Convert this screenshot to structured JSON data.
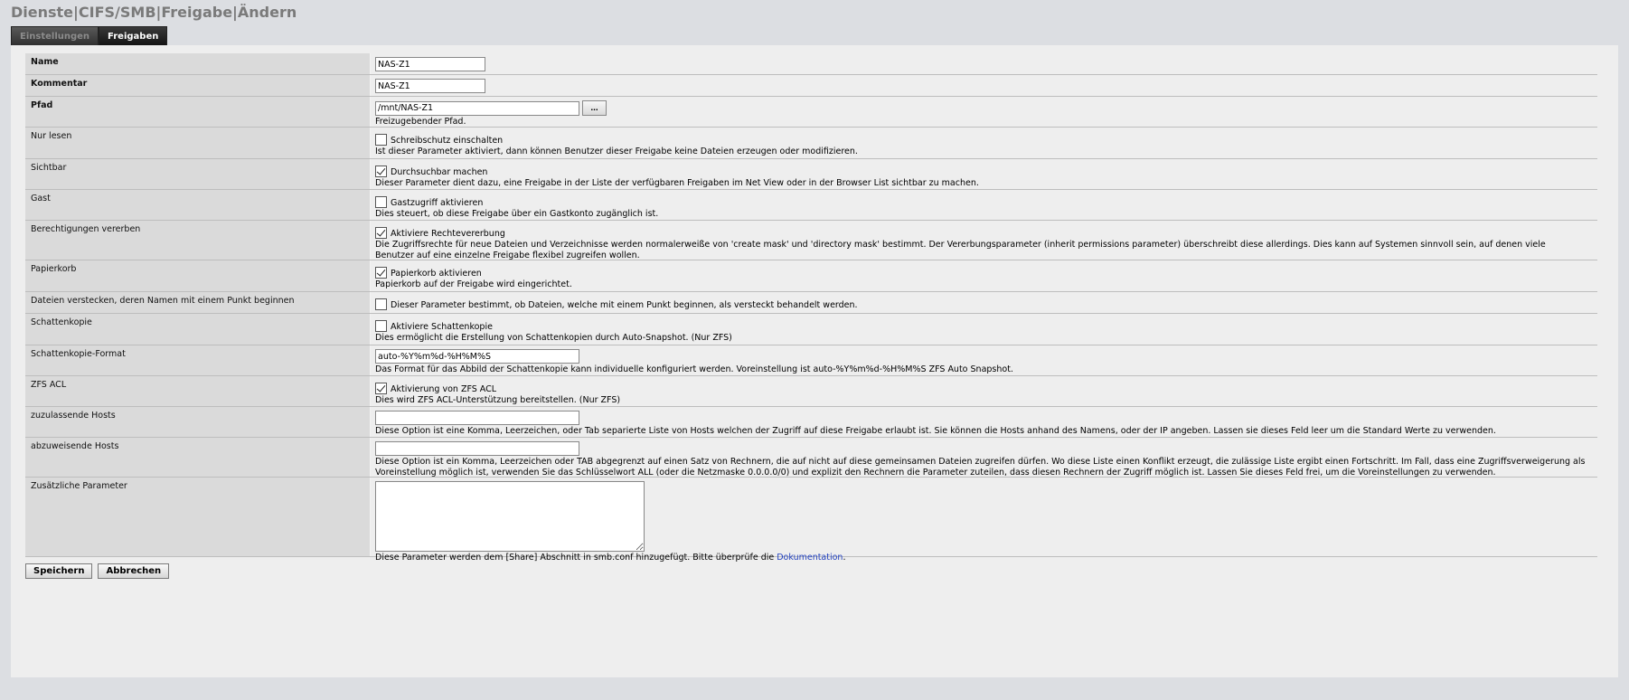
{
  "breadcrumb": "Dienste|CIFS/SMB|Freigabe|Ändern",
  "tabs": [
    {
      "label": "Einstellungen",
      "active": false
    },
    {
      "label": "Freigaben",
      "active": true
    }
  ],
  "fields": {
    "name": {
      "label": "Name",
      "value": "NAS-Z1"
    },
    "comment": {
      "label": "Kommentar",
      "value": "NAS-Z1"
    },
    "path": {
      "label": "Pfad",
      "value": "/mnt/NAS-Z1",
      "browse": "...",
      "desc": "Freizugebender Pfad."
    },
    "readonly": {
      "label": "Nur lesen",
      "checkbox": "Schreibschutz einschalten",
      "checked": false,
      "desc": "Ist dieser Parameter aktiviert, dann können Benutzer dieser Freigabe keine Dateien erzeugen oder modifizieren."
    },
    "browseable": {
      "label": "Sichtbar",
      "checkbox": "Durchsuchbar machen",
      "checked": true,
      "desc": "Dieser Parameter dient dazu, eine Freigabe in der Liste der verfügbaren Freigaben im Net View oder in der Browser List sichtbar zu machen."
    },
    "guest": {
      "label": "Gast",
      "checkbox": "Gastzugriff aktivieren",
      "checked": false,
      "desc": "Dies steuert, ob diese Freigabe über ein Gastkonto zugänglich ist."
    },
    "inherit": {
      "label": "Berechtigungen vererben",
      "checkbox": "Aktiviere Rechtevererbung",
      "checked": true,
      "desc": "Die Zugriffsrechte für neue Dateien und Verzeichnisse werden normalerweiße von 'create mask' und 'directory mask' bestimmt. Der Vererbungsparameter (inherit permissions parameter) überschreibt diese allerdings. Dies kann auf Systemen sinnvoll sein, auf denen viele Benutzer auf eine einzelne Freigabe flexibel zugreifen wollen."
    },
    "recycle": {
      "label": "Papierkorb",
      "checkbox": "Papierkorb aktivieren",
      "checked": true,
      "desc": "Papierkorb auf der Freigabe wird eingerichtet."
    },
    "hidedot": {
      "label": "Dateien verstecken, deren Namen mit einem Punkt beginnen",
      "checkbox": "Dieser Parameter bestimmt, ob Dateien, welche mit einem Punkt beginnen, als versteckt behandelt werden.",
      "checked": false
    },
    "shadowcopy": {
      "label": "Schattenkopie",
      "checkbox": "Aktiviere Schattenkopie",
      "checked": false,
      "desc": "Dies ermöglicht die Erstellung von Schattenkopien durch Auto-Snapshot. (Nur ZFS)"
    },
    "shadowformat": {
      "label": "Schattenkopie-Format",
      "value": "auto-%Y%m%d-%H%M%S",
      "desc": "Das Format für das Abbild der Schattenkopie kann individuelle konfiguriert werden. Voreinstellung ist auto-%Y%m%d-%H%M%S ZFS Auto Snapshot."
    },
    "zfsacl": {
      "label": "ZFS ACL",
      "checkbox": "Aktivierung von ZFS ACL",
      "checked": true,
      "desc": "Dies wird ZFS ACL-Unterstützung bereitstellen. (Nur ZFS)"
    },
    "hostsallow": {
      "label": "zuzulassende Hosts",
      "value": "",
      "desc": "Diese Option ist eine Komma, Leerzeichen, oder Tab separierte Liste von Hosts welchen der Zugriff auf diese Freigabe erlaubt ist. Sie können die Hosts anhand des Namens, oder der IP angeben. Lassen sie dieses Feld leer um die Standard Werte zu verwenden."
    },
    "hostsdeny": {
      "label": "abzuweisende Hosts",
      "value": "",
      "desc": "Diese Option ist ein Komma, Leerzeichen oder TAB abgegrenzt auf einen Satz von Rechnern, die auf nicht auf diese gemeinsamen Dateien zugreifen dürfen. Wo diese Liste einen Konflikt erzeugt, die zulässige Liste ergibt einen Fortschritt. Im Fall, dass eine Zugriffsverweigerung als Voreinstellung möglich ist, verwenden Sie das Schlüsselwort ALL (oder die Netzmaske 0.0.0.0/0) und explizit den Rechnern die Parameter zuteilen, dass diesen Rechnern der Zugriff möglich ist. Lassen Sie dieses Feld frei, um die Voreinstellungen zu verwenden."
    },
    "auxparam": {
      "label": "Zusätzliche Parameter",
      "value": "",
      "desc_pre": "Diese Parameter werden dem [Share] Abschnitt in smb.conf hinzugefügt. Bitte überprüfe die ",
      "link": "Dokumentation",
      "desc_post": "."
    }
  },
  "buttons": {
    "save": "Speichern",
    "cancel": "Abbrechen"
  }
}
